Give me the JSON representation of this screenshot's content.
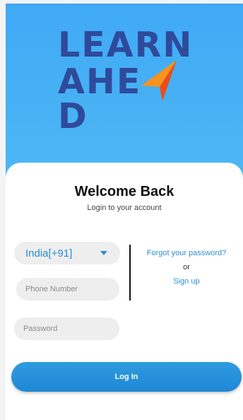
{
  "logo": {
    "line1": "LEARN",
    "line2": "AHE",
    "line2_end": "D",
    "brand_color": "#2f4a9b",
    "arrow_colors": [
      "#f7931e",
      "#e84e1b"
    ]
  },
  "card": {
    "title": "Welcome Back",
    "subtitle": "Login to your account"
  },
  "form": {
    "country_value": "India[+91]",
    "phone_placeholder": "Phone Number",
    "password_placeholder": "Password",
    "login_label": "Log In"
  },
  "links": {
    "forgot": "Forgot your password?",
    "or": "or",
    "signup": "Sign up"
  },
  "colors": {
    "header_gradient_top": "#3fa9f5",
    "accent": "#2a8fd4",
    "button": "#1e88d6"
  }
}
